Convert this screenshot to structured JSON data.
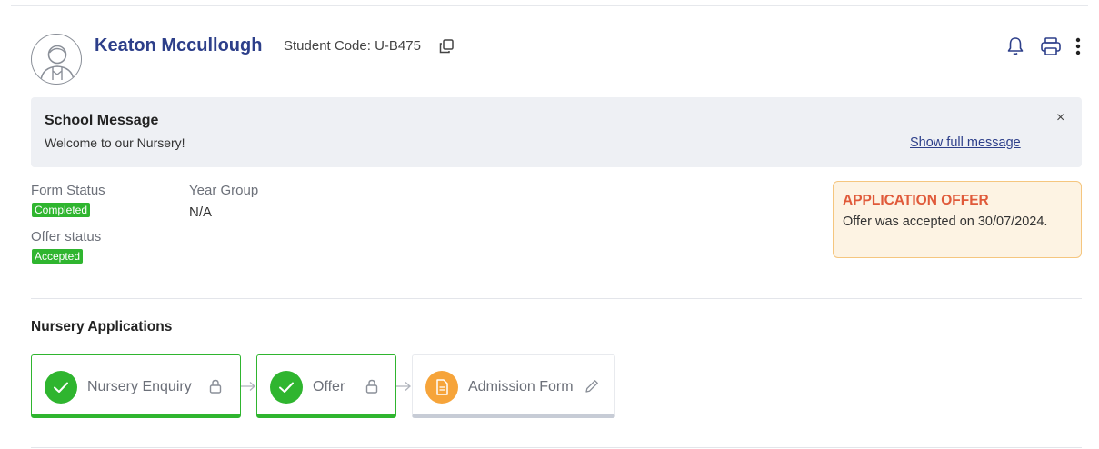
{
  "header": {
    "student_name": "Keaton Mccullough",
    "student_code": "Student Code: U-B475"
  },
  "message": {
    "title": "School Message",
    "text": "Welcome to our Nursery!",
    "close": "×",
    "link": "Show full message"
  },
  "status": {
    "form_status_label": "Form Status",
    "form_status_value": "Completed",
    "offer_status_label": "Offer status",
    "offer_status_value": "Accepted",
    "year_group_label": "Year Group",
    "year_group_value": "N/A"
  },
  "offer": {
    "title": "APPLICATION OFFER",
    "text": "Offer was accepted on 30/07/2024."
  },
  "applications": {
    "title": "Nursery Applications",
    "steps": [
      {
        "label": "Nursery Enquiry",
        "state": "completed",
        "icon": "lock-icon"
      },
      {
        "label": "Offer",
        "state": "completed",
        "icon": "lock-icon"
      },
      {
        "label": "Admission Form",
        "state": "in-progress",
        "icon": "pencil-icon"
      }
    ]
  },
  "colors": {
    "brand": "#2d3f8a",
    "success": "#2fb52f",
    "warning": "#f6a43a",
    "offer_title": "#e05a3a"
  }
}
